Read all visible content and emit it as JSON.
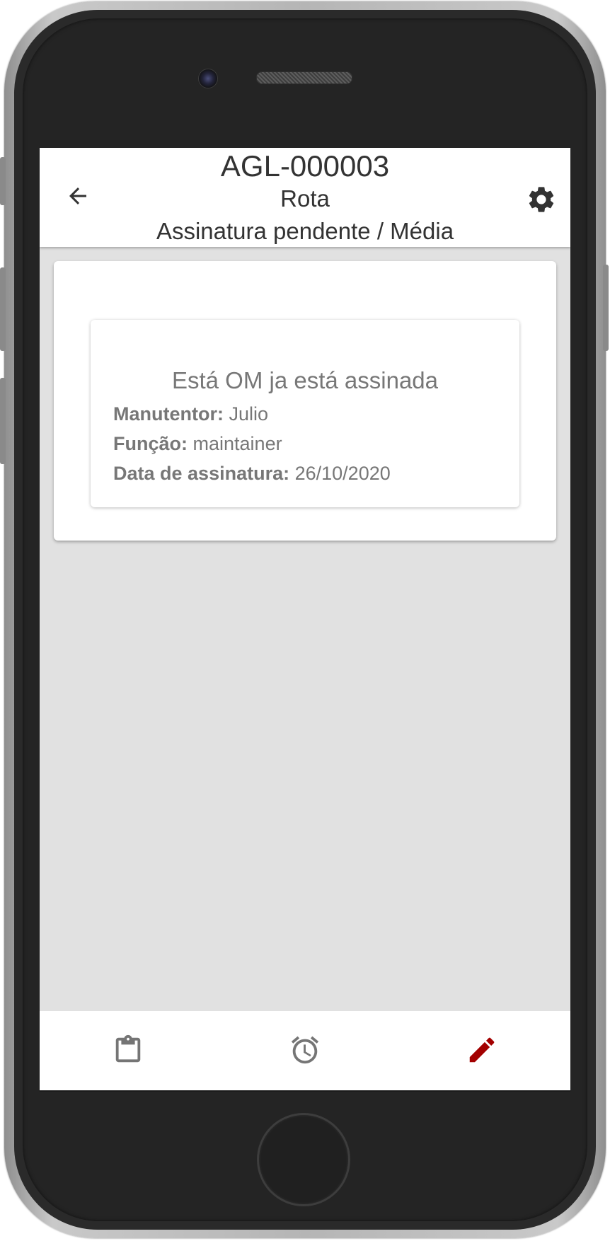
{
  "header": {
    "id": "AGL-000003",
    "type": "Rota",
    "status": "Assinatura pendente / Média",
    "back_icon": "arrow-left-icon",
    "settings_icon": "gear-icon"
  },
  "signature_info": {
    "title": "Está OM ja está assinada",
    "maintainer_label": "Manutentor:",
    "maintainer_value": "Julio",
    "role_label": "Função:",
    "role_value": "maintainer",
    "date_label": "Data de assinatura:",
    "date_value": "26/10/2020"
  },
  "bottom_nav": {
    "items": [
      {
        "icon": "clipboard-icon",
        "active": false
      },
      {
        "icon": "alarm-clock-icon",
        "active": false
      },
      {
        "icon": "pencil-icon",
        "active": true
      }
    ],
    "active_color": "#a30000",
    "inactive_color": "#757575"
  },
  "colors": {
    "screen_background": "#e1e1e1",
    "text_primary": "#333333",
    "text_secondary": "#777777"
  }
}
